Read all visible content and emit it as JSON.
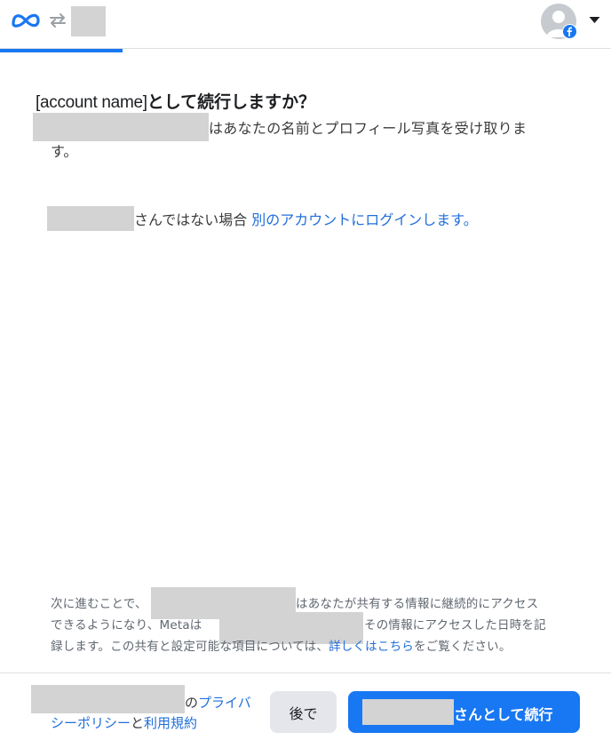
{
  "header": {
    "logo_icon": "meta-infinity-logo",
    "swap_icon": "arrows-swap-icon",
    "avatar_icon": "default-profile-avatar",
    "badge_icon": "facebook-badge",
    "dropdown_icon": "caret-down-icon",
    "progress": 0.2
  },
  "main": {
    "title_name": "[account name]",
    "title_suffix": "として続行しますか？",
    "desc_line1": "はあなたの名前とプロフィール写真を受け取りま",
    "desc_line2": "す。",
    "not_you_text": "さんではない場合 ",
    "not_you_link": "別のアカウントにログインします。"
  },
  "disclosure": {
    "l1a": "次に進むことで、",
    "l1b": "はあなたが共有する情報に継続的にアクセス",
    "l2a": "できるようになり、Metaは",
    "l2b": "その情報にアクセスした日時を記",
    "l3a": "録します。この共有と設定可能な項目については、",
    "l3_link": "詳しくはこちら",
    "l3b": "をご覧ください。"
  },
  "footer": {
    "policy_prefix": "の",
    "privacy_l1": "プライバ",
    "privacy_l2": "シーポリシー",
    "and": "と",
    "terms": "利用規約",
    "later_label": "後で",
    "continue_label": "さんとして続行"
  },
  "colors": {
    "primary": "#1877f2",
    "link": "#216fdb",
    "secondary_button": "#e4e6eb",
    "redaction": "#d3d3d3"
  }
}
